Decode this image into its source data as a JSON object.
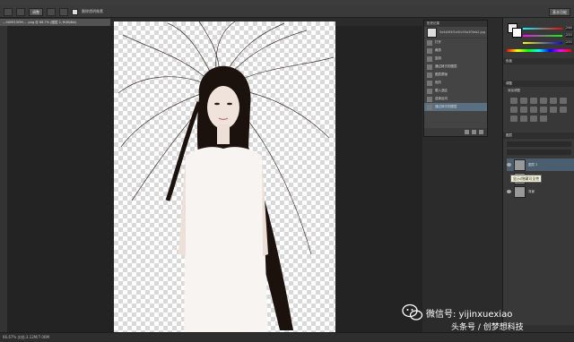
{
  "app": {
    "name": "Photoshop"
  },
  "options_bar": {
    "button_label": "调整",
    "checkbox_label": "删除透明像素",
    "right_label": "基本功能"
  },
  "document": {
    "tab_title": "…f409f15f59… .png @ 66.7% (图层 2, RGB/8#)",
    "zoom": "66.67%",
    "status": "文档:3.12M/7.06M"
  },
  "history": {
    "title": "历史记录",
    "snapshot": "5e4b5f4f1e5fc55a3f5eb2.jpg",
    "items": [
      "打开",
      "裁剪",
      "复制",
      "通过拷贝的图层",
      "图层蒙版",
      "色阶",
      "载入选区",
      "选择反向",
      "通过拷贝的图层"
    ],
    "selected_index": 8
  },
  "color_panel": {
    "r": "246",
    "g": "233",
    "b": "233",
    "fg": "#f0eaea",
    "bg": "#ffffff"
  },
  "panels": {
    "swatches_tab": "色板",
    "adjust_tab": "调整",
    "adjust_label": "添加调整",
    "layers_tab": "图层"
  },
  "layers": {
    "items": [
      {
        "name": "图层 2",
        "visible": true,
        "selected": true
      },
      {
        "name": "图层 1",
        "visible": false,
        "selected": false
      },
      {
        "name": "背景",
        "visible": true,
        "selected": false
      }
    ],
    "tooltip": "显示/隐藏可见性"
  },
  "watermark": {
    "line1": "微信号: yijinxuexiao",
    "line2": "头条号 / 创梦想科技"
  }
}
